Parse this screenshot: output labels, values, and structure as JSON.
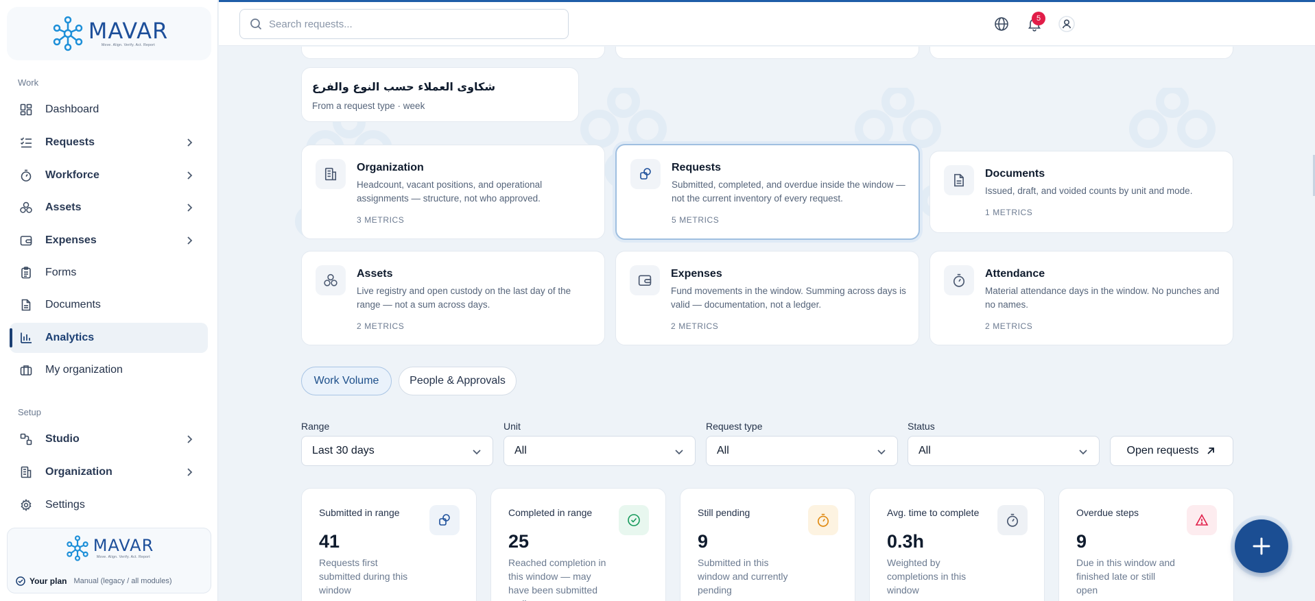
{
  "brand": {
    "name": "MAVAR",
    "tagline": "Move. Align. Verify. Act. Report"
  },
  "sidebar": {
    "section_work": "Work",
    "section_setup": "Setup",
    "items": [
      {
        "label": "Dashboard",
        "icon": "grid-icon"
      },
      {
        "label": "Requests",
        "icon": "checklist-icon"
      },
      {
        "label": "Workforce",
        "icon": "timer-icon"
      },
      {
        "label": "Assets",
        "icon": "cubes-icon"
      },
      {
        "label": "Expenses",
        "icon": "wallet-icon"
      },
      {
        "label": "Forms",
        "icon": "clipboard-icon"
      },
      {
        "label": "Documents",
        "icon": "document-icon"
      },
      {
        "label": "Analytics",
        "icon": "bar-chart-icon"
      },
      {
        "label": "My organization",
        "icon": "briefcase-icon"
      },
      {
        "label": "Studio",
        "icon": "workflow-icon"
      },
      {
        "label": "Organization",
        "icon": "building-icon"
      },
      {
        "label": "Settings",
        "icon": "gear-icon"
      }
    ],
    "active": "Analytics",
    "plan": {
      "title": "Your plan",
      "value": "Manual (legacy / all modules)"
    }
  },
  "topbar": {
    "search_placeholder": "Search requests...",
    "notification_count": "5"
  },
  "report_card": {
    "title": "شكاوى العملاء حسب النوع والفرع",
    "subtitle": "From a request type · week"
  },
  "modules": [
    {
      "title": "Organization",
      "desc": "Headcount, vacant positions, and operational assignments — structure, not who approved.",
      "count": "3 METRICS"
    },
    {
      "title": "Requests",
      "desc": "Submitted, completed, and overdue inside the window — not the current inventory of every request.",
      "count": "5 METRICS"
    },
    {
      "title": "Documents",
      "desc": "Issued, draft, and voided counts by unit and mode.",
      "count": "1 METRICS"
    },
    {
      "title": "Assets",
      "desc": "Live registry and open custody on the last day of the range — not a sum across days.",
      "count": "2 METRICS"
    },
    {
      "title": "Expenses",
      "desc": "Fund movements in the window. Summing across days is valid — documentation, not a ledger.",
      "count": "2 METRICS"
    },
    {
      "title": "Attendance",
      "desc": "Material attendance days in the window. No punches and no names.",
      "count": "2 METRICS"
    }
  ],
  "tabs": {
    "work_volume": "Work Volume",
    "people_approvals": "People & Approvals"
  },
  "filters": {
    "range": {
      "label": "Range",
      "value": "Last 30 days"
    },
    "unit": {
      "label": "Unit",
      "value": "All"
    },
    "request_type": {
      "label": "Request type",
      "value": "All"
    },
    "status": {
      "label": "Status",
      "value": "All"
    },
    "open_button": "Open requests"
  },
  "kpis": [
    {
      "label": "Submitted in range",
      "value": "41",
      "desc": "Requests first submitted during this window",
      "icon": "copy-icon",
      "color": "#1d4f9a"
    },
    {
      "label": "Completed in range",
      "value": "25",
      "desc": "Reached completion in this window — may have been submitted earlier",
      "icon": "check-circle-icon",
      "color": "#15995a"
    },
    {
      "label": "Still pending",
      "value": "9",
      "desc": "Submitted in this window and currently pending",
      "icon": "stopwatch-icon",
      "color": "#e08a12"
    },
    {
      "label": "Avg. time to complete",
      "value": "0.3h",
      "desc": "Weighted by completions in this window",
      "icon": "stopwatch-icon",
      "color": "#4a5870"
    },
    {
      "label": "Overdue steps",
      "value": "9",
      "desc": "Due in this window and finished late or still open",
      "icon": "warning-icon",
      "color": "#e11d48"
    }
  ]
}
